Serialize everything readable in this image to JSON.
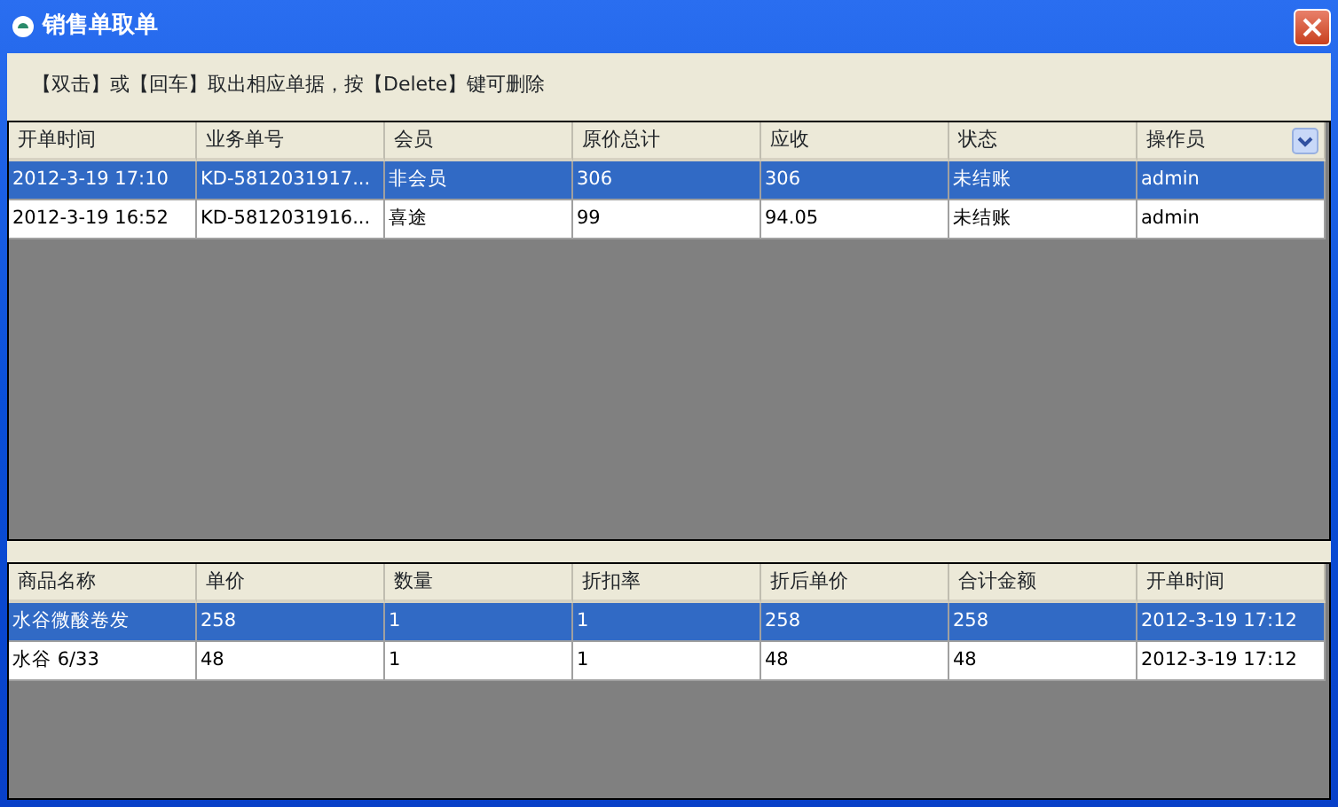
{
  "window": {
    "title": "销售单取单"
  },
  "hint": "【双击】或【回车】取出相应单据，按【Delete】键可删除",
  "orders": {
    "columns": [
      "开单时间",
      "业务单号",
      "会员",
      "原价总计",
      "应收",
      "状态",
      "操作员"
    ],
    "rows": [
      {
        "cells": [
          "2012-3-19 17:10",
          "KD-5812031917...",
          "非会员",
          "306",
          "306",
          "未结账",
          "admin"
        ],
        "selected": true
      },
      {
        "cells": [
          "2012-3-19 16:52",
          "KD-5812031916...",
          "喜途",
          "99",
          "94.05",
          "未结账",
          "admin"
        ],
        "selected": false
      }
    ]
  },
  "items": {
    "columns": [
      "商品名称",
      "单价",
      "数量",
      "折扣率",
      "折后单价",
      "合计金额",
      "开单时间"
    ],
    "rows": [
      {
        "cells": [
          "水谷微酸卷发",
          "258",
          "1",
          "1",
          "258",
          "258",
          "2012-3-19 17:12"
        ],
        "selected": true
      },
      {
        "cells": [
          "水谷 6/33",
          "48",
          "1",
          "1",
          "48",
          "48",
          "2012-3-19 17:12"
        ],
        "selected": false
      }
    ]
  }
}
